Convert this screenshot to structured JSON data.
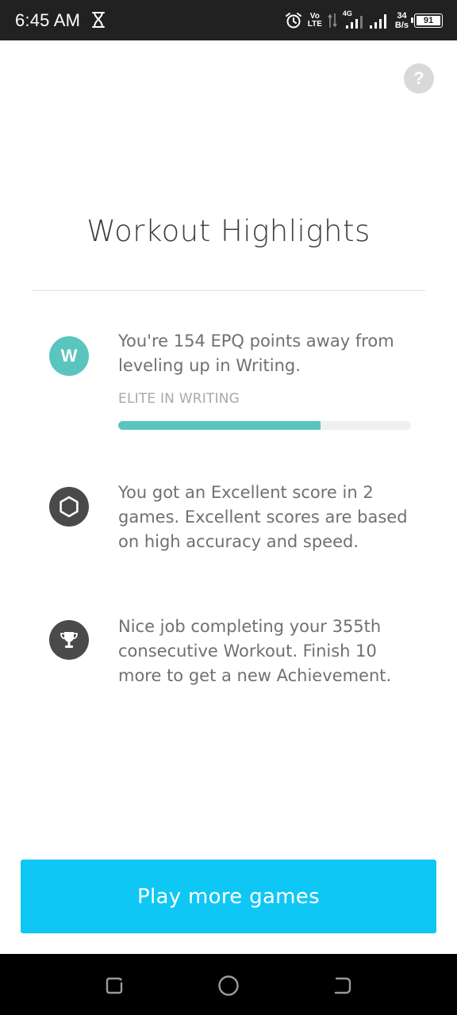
{
  "status_bar": {
    "time": "6:45 AM",
    "network_label_top": "Vo",
    "network_label_bottom": "LTE",
    "signal_label": "4G",
    "speed_value": "34",
    "speed_unit": "B/s",
    "battery_level": "91"
  },
  "help": {
    "label": "?"
  },
  "title": "Workout Highlights",
  "highlights": [
    {
      "icon_letter": "W",
      "text": "You're 154 EPQ points away from leveling up in Writing.",
      "sub_label": "ELITE IN WRITING",
      "progress_fraction": 0.69
    },
    {
      "icon": "hexagon-icon",
      "text": "You got an Excellent score in 2 games. Excellent scores are based on high accuracy and speed."
    },
    {
      "icon": "trophy-icon",
      "text": "Nice job completing your 355th consecutive Workout. Finish 10 more to get a new Achievement."
    }
  ],
  "cta": {
    "label": "Play more games"
  },
  "colors": {
    "accent_teal": "#59c5be",
    "cta_blue": "#0fc7f4",
    "icon_dark": "#4a4a4a"
  }
}
